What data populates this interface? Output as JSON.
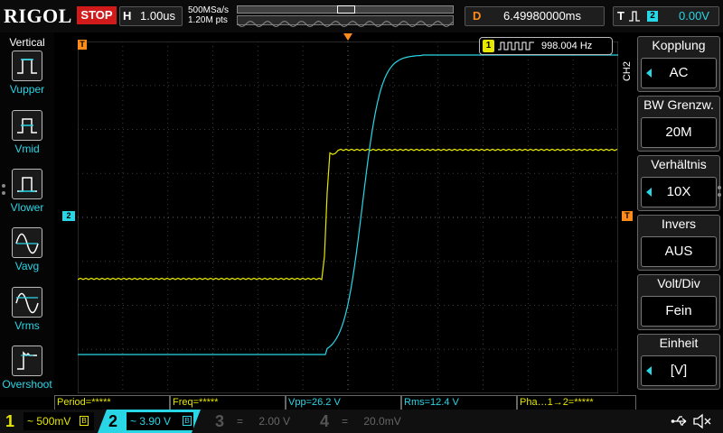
{
  "topbar": {
    "brand": "RIGOL",
    "run_status": "STOP",
    "horizontal_label": "H",
    "timebase": "1.00us",
    "sample_rate": "500MSa/s",
    "memory_depth": "1.20M pts",
    "delay_label": "D",
    "delay_value": "6.49980000ms",
    "trigger_label": "T",
    "trigger_source": "2",
    "trigger_level": "0.00V"
  },
  "leftmenu": {
    "title": "Vertical",
    "items": [
      {
        "label": "Vupper",
        "icon": "vupper-pulse-icon"
      },
      {
        "label": "Vmid",
        "icon": "vmid-pulse-icon"
      },
      {
        "label": "Vlower",
        "icon": "vlower-pulse-icon"
      },
      {
        "label": "Vavg",
        "icon": "vavg-sine-icon"
      },
      {
        "label": "Vrms",
        "icon": "vrms-sine-icon"
      },
      {
        "label": "Overshoot",
        "icon": "overshoot-edge-icon"
      }
    ]
  },
  "display": {
    "frequency_channel": "1",
    "frequency_value": "998.004 Hz",
    "ch2_marker": "2",
    "trigger_position_marker": "T",
    "trigger_level_marker": "T"
  },
  "rightmenu": {
    "channel_tag": "CH2",
    "items": [
      {
        "header": "Kopplung",
        "value": "AC",
        "has_arrow": true
      },
      {
        "header": "BW Grenzw.",
        "value": "20M",
        "has_arrow": false
      },
      {
        "header": "Verhältnis",
        "value": "10X",
        "has_arrow": true
      },
      {
        "header": "Invers",
        "value": "AUS",
        "has_arrow": false
      },
      {
        "header": "Volt/Div",
        "value": "Fein",
        "has_arrow": false
      },
      {
        "header": "Einheit",
        "value": "[V]",
        "has_arrow": true
      }
    ]
  },
  "measurements": [
    {
      "text": "Period=*****",
      "color": "yellow"
    },
    {
      "text": "Freq=*****",
      "color": "yellow"
    },
    {
      "text": "Vpp=26.2 V",
      "color": "cyan"
    },
    {
      "text": "Rms=12.4 V",
      "color": "cyan"
    },
    {
      "text": "Pha…1→2=*****",
      "color": "yellow"
    }
  ],
  "channels": [
    {
      "number": "1",
      "coupling": "~",
      "scale": "500mV",
      "color": "#e6e600",
      "active": true
    },
    {
      "number": "2",
      "coupling": "~",
      "scale": "3.90 V",
      "color": "#29d6e6",
      "active": true
    },
    {
      "number": "3",
      "coupling": "=",
      "scale": "2.00 V",
      "color": "#555555",
      "active": false
    },
    {
      "number": "4",
      "coupling": "=",
      "scale": "20.0mV",
      "color": "#555555",
      "active": false
    }
  ],
  "colors": {
    "ch1": "#e6e600",
    "ch2": "#29d6e6",
    "trigger": "#ff8c1a",
    "stop": "#d11a1a"
  }
}
